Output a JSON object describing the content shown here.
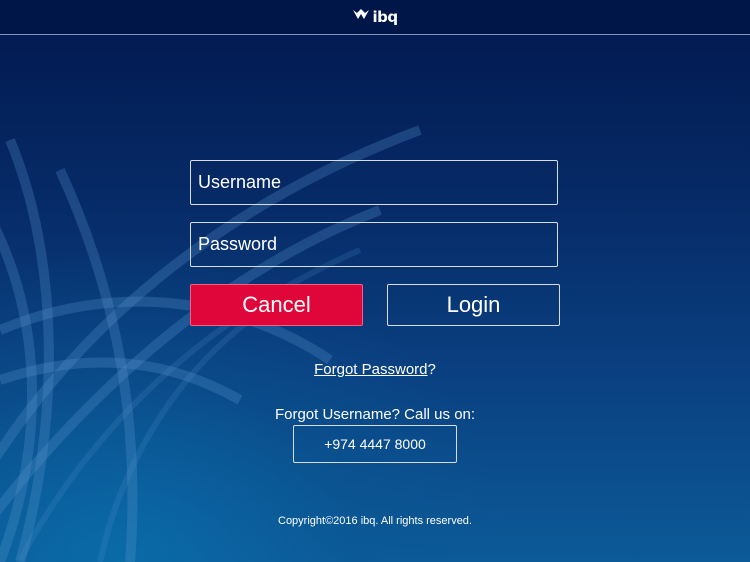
{
  "header": {
    "logo_text": "ibq",
    "logo_icon": "ibq-wings-logo-icon"
  },
  "login_form": {
    "username_placeholder": "Username",
    "password_placeholder": "Password",
    "cancel_label": "Cancel",
    "login_label": "Login"
  },
  "links": {
    "forgot_password": "Forgot Password",
    "forgot_password_suffix": "?",
    "forgot_username_text": "Forgot Username? Call us on:",
    "phone_number": "+974 4447 8000"
  },
  "footer": {
    "copyright": "Copyright©2016 ibq. All rights reserved."
  },
  "colors": {
    "background_top": "#02184f",
    "background_bottom": "#0c5a98",
    "cancel_button": "#e0063a",
    "text": "#ffffff"
  }
}
